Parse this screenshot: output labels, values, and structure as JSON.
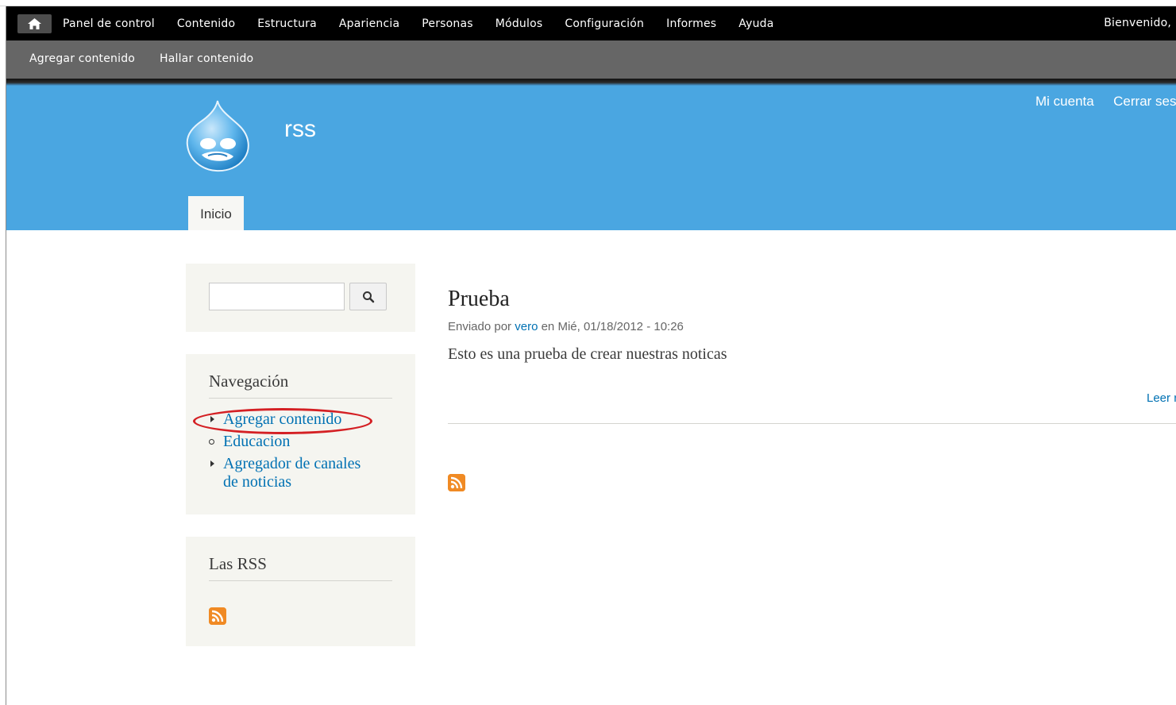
{
  "toolbar": {
    "home_icon": "home-icon",
    "menu": [
      "Panel de control",
      "Contenido",
      "Estructura",
      "Apariencia",
      "Personas",
      "Módulos",
      "Configuración",
      "Informes",
      "Ayuda"
    ],
    "welcome": "Bienvenido,",
    "shortcuts": [
      "Agregar contenido",
      "Hallar contenido"
    ]
  },
  "header": {
    "site_name": "rss",
    "logo_icon": "drupal-drop-logo",
    "secondary_menu": [
      "Mi cuenta",
      "Cerrar ses"
    ],
    "tabs": [
      "Inicio"
    ],
    "color": "#4aa6e1"
  },
  "search": {
    "value": "",
    "button_icon": "search-icon"
  },
  "navigation": {
    "title": "Navegación",
    "items": [
      "Agregar contenido",
      "Educacion",
      "Agregador de canales",
      "de noticias"
    ],
    "highlight_color": "#d42024"
  },
  "rss_block": {
    "title": "Las RSS",
    "icon": "rss-feed-icon"
  },
  "node": {
    "title": "Prueba",
    "submitted_prefix": "Enviado por",
    "author": "vero",
    "submitted_suffix": "en Mié, 01/18/2012 - 10:26",
    "body": "Esto es una prueba de crear nuestras noticas",
    "read_more": "Leer r",
    "feed_icon": "rss-feed-icon"
  }
}
